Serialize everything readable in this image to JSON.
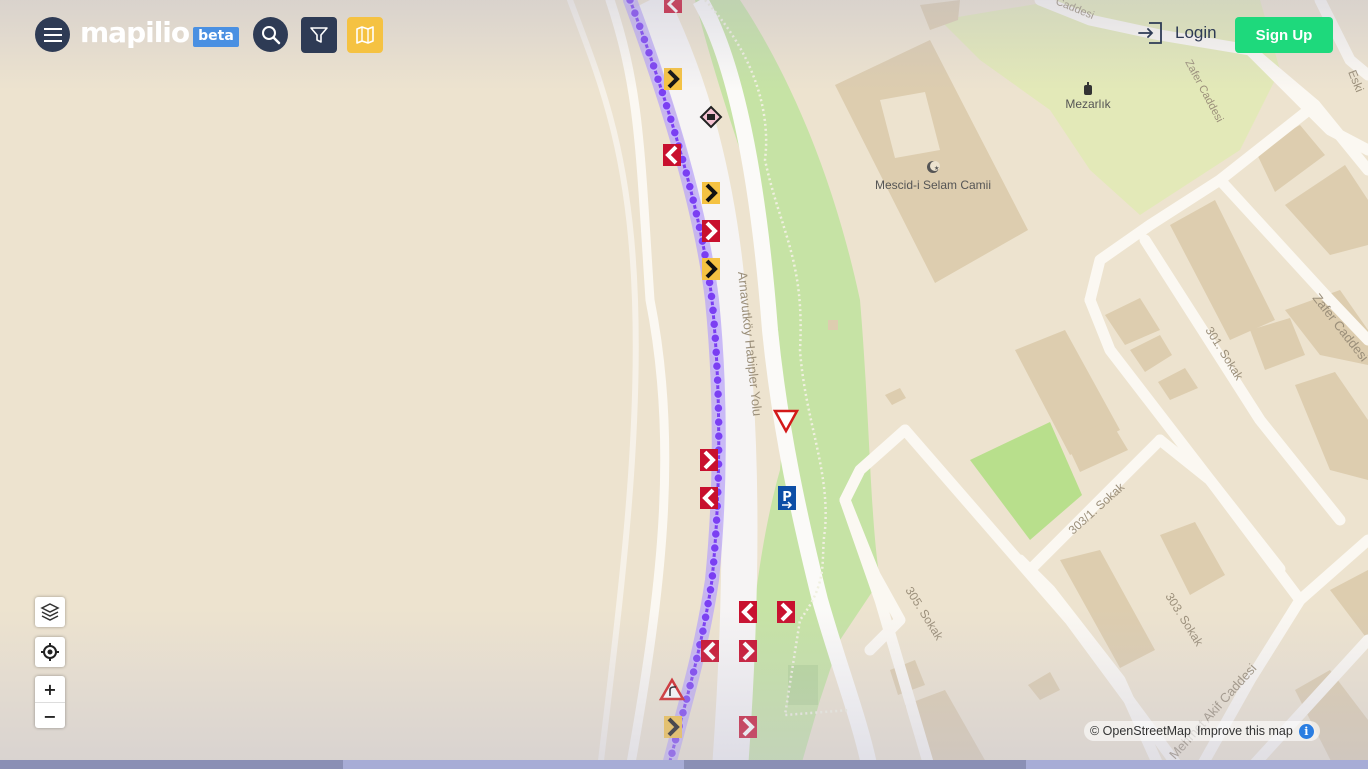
{
  "header": {
    "menu_icon": "hamburger-menu-icon",
    "logo_text": "mapilio",
    "beta_label": "beta",
    "search_icon": "search-icon",
    "filter_icon": "filter-icon",
    "map_icon": "map-icon",
    "login_label": "Login",
    "login_icon": "login-door-icon",
    "signup_label": "Sign Up"
  },
  "colors": {
    "nav_dark": "#2e3b55",
    "accent_yellow": "#f5c242",
    "signup_green": "#1ed97c",
    "beta_blue": "#4a90e2",
    "sequence_purple": "#7b3ff2",
    "land": "#ede3cf",
    "park": "#c6e3a5",
    "road": "#ffffff",
    "building": "#ddcdaf"
  },
  "map": {
    "labels": {
      "road_main": "Arnavutköy Habipler Yolu",
      "poi_mosque": "Mescid-i Selam Camii",
      "poi_cemetery": "Mezarlık",
      "street_zafer_top": "Zafer Caddesi",
      "street_zafer_right": "Zafer Caddesi",
      "street_301": "301. Sokak",
      "street_303_1": "303/1. Sokak",
      "street_305": "305. Sokak",
      "street_303": "303. Sokak",
      "street_mehmet": "Mehmet Akif Caddesi",
      "street_eski": "Eski",
      "street_top_cut": "Caddesi"
    }
  },
  "controls": {
    "layers_icon": "layers-icon",
    "locate_icon": "locate-crosshair-icon",
    "zoom_in_label": "+",
    "zoom_out_label": "−"
  },
  "attribution": {
    "text": "© OpenStreetMap",
    "improve_link": "Improve this map",
    "info_label": "i"
  }
}
